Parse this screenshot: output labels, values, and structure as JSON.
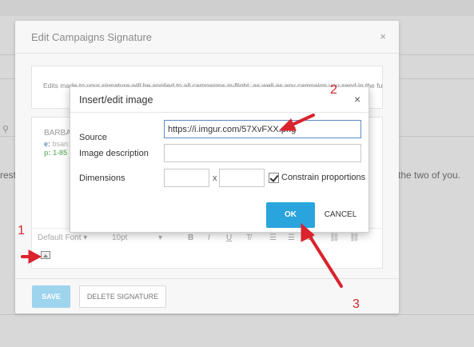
{
  "background": {
    "left_text": "rest",
    "right_text": "the two of you."
  },
  "signature_modal": {
    "title": "Edit Campaigns Signature",
    "close_glyph": "×",
    "notice": "Edits made to your signature will be applied to all campaigns in-flight, as well as any campaign you send in the future.",
    "signature": {
      "name": "BARBA",
      "email_key": "e:",
      "email_value": "bsan",
      "phone_key": "p:",
      "phone_value": "1-85"
    },
    "toolbar": {
      "font_family": "Default Font",
      "font_size": "10pt"
    },
    "save_label": "SAVE",
    "delete_label": "DELETE SIGNATURE"
  },
  "insert_image_dialog": {
    "title": "Insert/edit image",
    "close_glyph": "×",
    "source_label": "Source",
    "source_value": "https://i.imgur.com/57XvFXX.png",
    "description_label": "Image description",
    "description_value": "",
    "dimensions_label": "Dimensions",
    "width_value": "",
    "height_value": "",
    "dimension_separator": "x",
    "constrain_label": "Constrain proportions",
    "constrain_checked": true,
    "ok_label": "OK",
    "cancel_label": "CANCEL"
  },
  "annotations": {
    "step1": "1",
    "step2": "2",
    "step3": "3",
    "color": "#d9232d"
  },
  "colors": {
    "accent": "#2aa4dd",
    "save_disabled": "#9fd4ee"
  }
}
